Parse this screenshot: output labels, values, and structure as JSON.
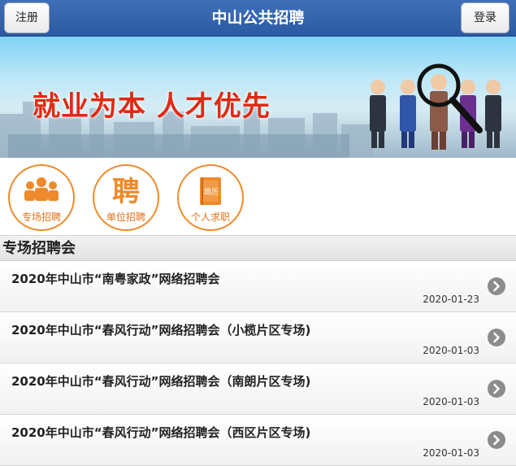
{
  "header": {
    "title": "中山公共招聘",
    "register_label": "注册",
    "login_label": "登录",
    "color": "#2f5fa8"
  },
  "banner": {
    "slogan": "就业为本  人才优先"
  },
  "categories": [
    {
      "label": "专场招聘",
      "icon": "people-group-icon"
    },
    {
      "label": "单位招聘",
      "icon": "recruit-character-icon",
      "glyph": "聘"
    },
    {
      "label": "个人求职",
      "icon": "resume-book-icon",
      "glyph": "简历"
    }
  ],
  "accent_color": "#ef8a2a",
  "section": {
    "title": "专场招聘会"
  },
  "jobfairs": [
    {
      "title": "2020年中山市“南粤家政”网络招聘会",
      "date": "2020-01-23"
    },
    {
      "title": "2020年中山市“春风行动”网络招聘会（小榄片区专场)",
      "date": "2020-01-03"
    },
    {
      "title": "2020年中山市“春风行动”网络招聘会（南朗片区专场)",
      "date": "2020-01-03"
    },
    {
      "title": "2020年中山市“春风行动”网络招聘会（西区片区专场)",
      "date": "2020-01-03"
    }
  ]
}
